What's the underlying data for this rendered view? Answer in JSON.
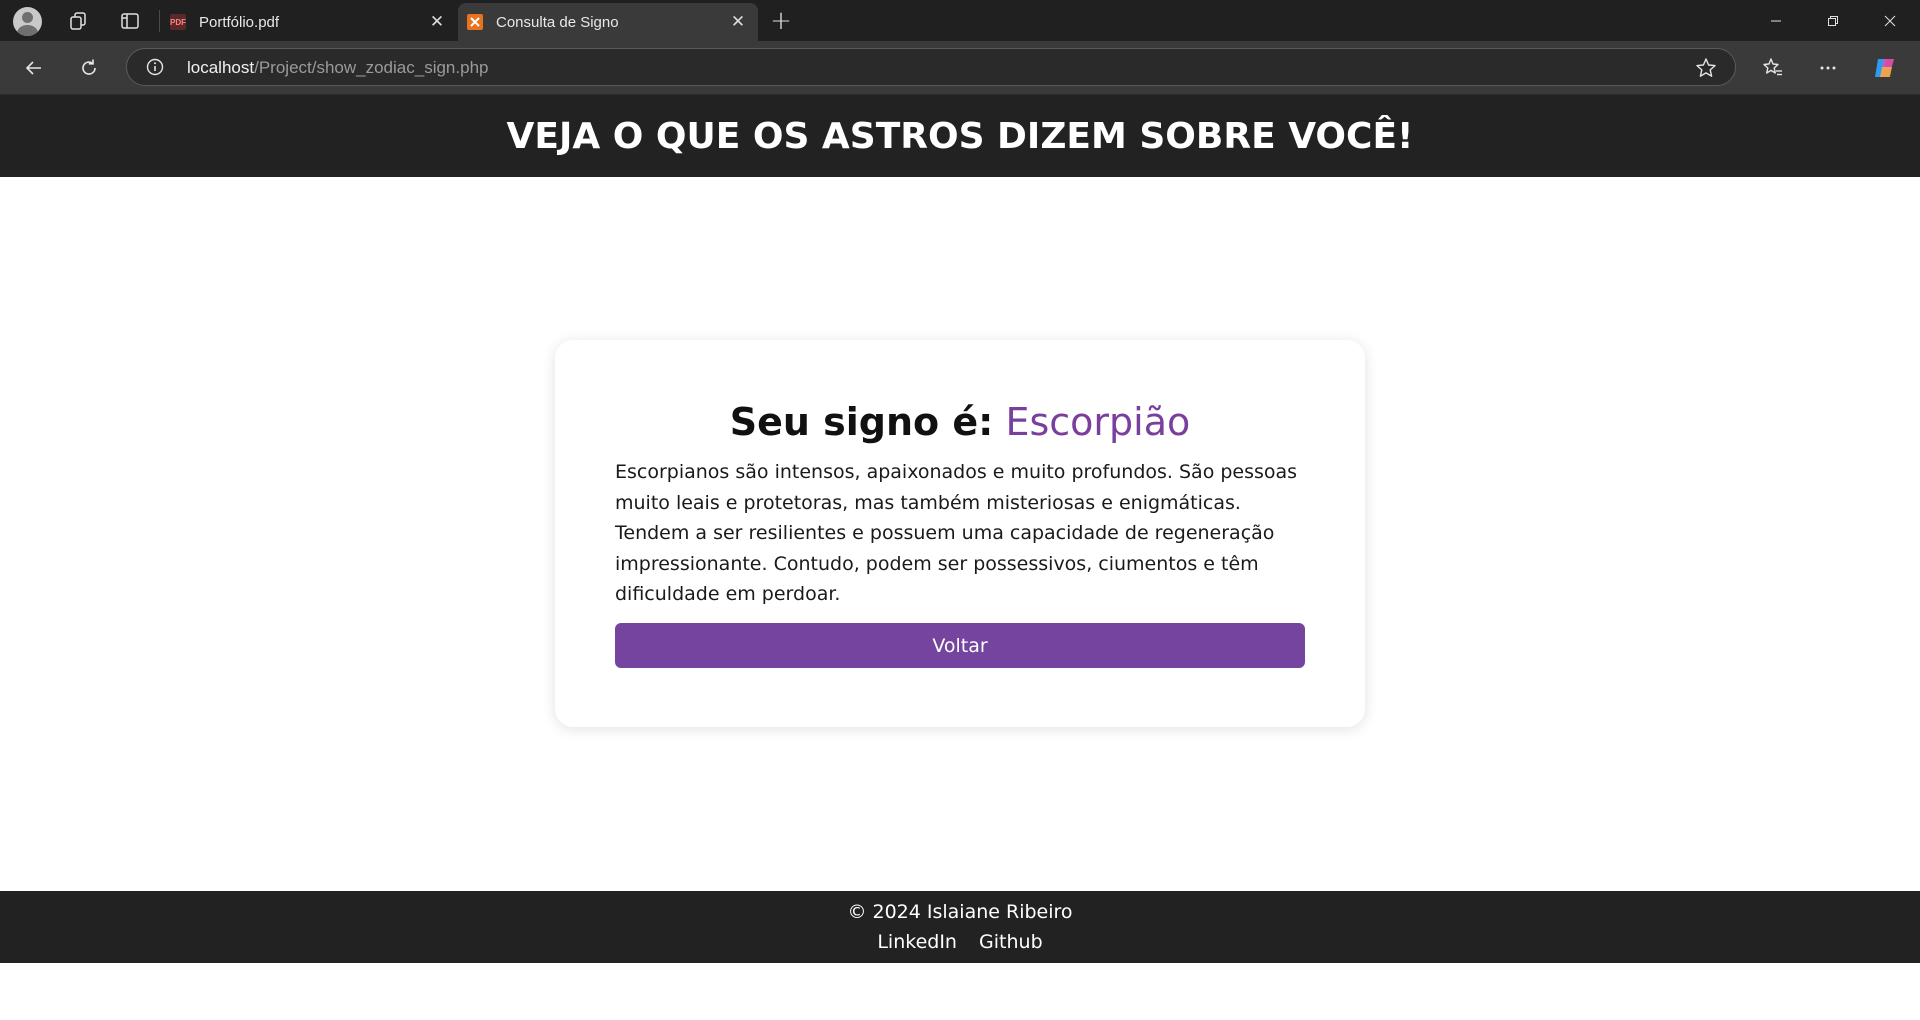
{
  "browser": {
    "tabs": [
      {
        "title": "Portfólio.pdf",
        "favicon": "pdf-icon",
        "active": false
      },
      {
        "title": "Consulta de Signo",
        "favicon": "xampp-icon",
        "active": true
      }
    ],
    "url": {
      "host": "localhost",
      "path": "/Project/show_zodiac_sign.php"
    }
  },
  "header": {
    "title": "VEJA O QUE OS ASTROS DIZEM SOBRE VOCÊ!"
  },
  "result": {
    "label": "Seu signo é:",
    "sign": "Escorpião",
    "description": "Escorpianos são intensos, apaixonados e muito profundos. São pessoas muito leais e protetoras, mas também misteriosas e enigmáticas. Tendem a ser resilientes e possuem uma capacidade de regeneração impressionante. Contudo, podem ser possessivos, ciumentos e têm dificuldade em perdoar.",
    "button": "Voltar"
  },
  "footer": {
    "copyright": "© 2024 Islaiane Ribeiro",
    "links": [
      "LinkedIn",
      "Github"
    ]
  },
  "colors": {
    "accent": "#74449f",
    "sign_text": "#7a3f9d",
    "header_bg": "#222222"
  }
}
